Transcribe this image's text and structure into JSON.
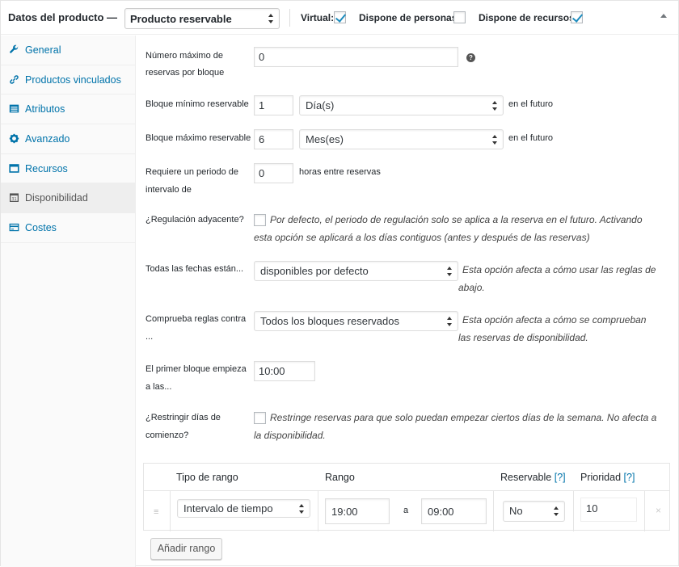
{
  "header": {
    "title": "Datos del producto —",
    "product_type": "Producto reservable",
    "virtual_label": "Virtual:",
    "persons_label": "Dispone de personas:",
    "resources_label": "Dispone de recursos:",
    "virtual_checked": true,
    "persons_checked": false,
    "resources_checked": true
  },
  "sidebar": {
    "items": [
      {
        "label": "General",
        "icon": "wrench-icon"
      },
      {
        "label": "Productos vinculados",
        "icon": "link-icon"
      },
      {
        "label": "Atributos",
        "icon": "list-icon"
      },
      {
        "label": "Avanzado",
        "icon": "gear-icon"
      },
      {
        "label": "Recursos",
        "icon": "window-icon"
      },
      {
        "label": "Disponibilidad",
        "icon": "calendar-icon",
        "active": true
      },
      {
        "label": "Costes",
        "icon": "card-icon"
      }
    ]
  },
  "form": {
    "max_bookings": {
      "label_1": "Número máximo de",
      "label_2": "reservas por bloque",
      "value": "0"
    },
    "min_block": {
      "label": "Bloque mínimo reservable",
      "value": "1",
      "unit": "Día(s)",
      "suffix": "en el futuro"
    },
    "max_block": {
      "label": "Bloque máximo reservable",
      "value": "6",
      "unit": "Mes(es)",
      "suffix": "en el futuro"
    },
    "buffer": {
      "label_1": "Requiere un periodo de",
      "label_2": "intervalo de",
      "value": "0",
      "suffix": "horas entre reservas"
    },
    "adjacent": {
      "label": "¿Regulación adyacente?",
      "desc_1": "Por defecto, el periodo de regulación solo se aplica a la reserva en el futuro. Activando",
      "desc_2": "esta opción se aplicará a los días contiguos (antes y después de las reservas)"
    },
    "all_dates": {
      "label": "Todas las fechas están...",
      "value": "disponibles por defecto",
      "desc_1": "Esta opción afecta a cómo usar las reglas de",
      "desc_2": "abajo."
    },
    "check_rules": {
      "label_1": "Comprueba reglas contra",
      "label_2": "...",
      "value": "Todos los bloques reservados",
      "desc_1": "Esta opción afecta a cómo se comprueban",
      "desc_2": "las reservas de disponibilidad."
    },
    "first_block": {
      "label_1": "El primer bloque empieza",
      "label_2": "a las...",
      "value": "10:00"
    },
    "restrict_days": {
      "label_1": "¿Restringir días de",
      "label_2": "comienzo?",
      "desc_1": "Restringe reservas para que solo puedan empezar ciertos días de la semana. No afecta a",
      "desc_2": "la disponibilidad."
    }
  },
  "ranges": {
    "headers": {
      "type": "Tipo de rango",
      "range": "Rango",
      "bookable": "Reservable",
      "bookable_help": "[?]",
      "priority": "Prioridad",
      "priority_help": "[?]"
    },
    "row": {
      "type": "Intervalo de tiempo",
      "from": "19:00",
      "sep": "a",
      "to": "09:00",
      "bookable": "No",
      "priority": "10"
    },
    "add_button": "Añadir rango"
  }
}
